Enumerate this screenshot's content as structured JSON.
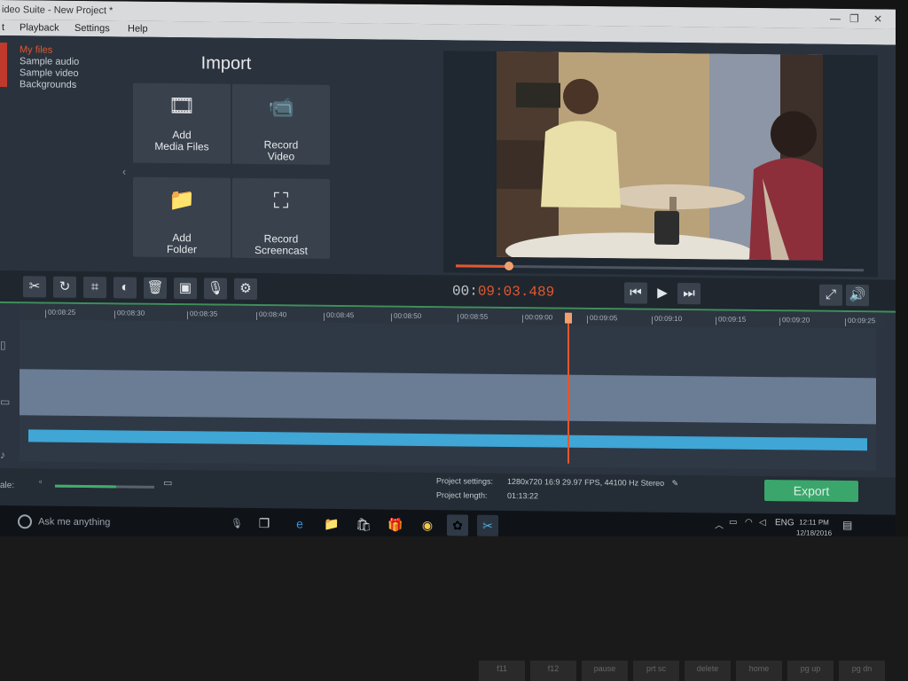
{
  "window": {
    "title": "ideo Suite - New Project *",
    "controls": [
      "—",
      "❐",
      "✕"
    ]
  },
  "menu": [
    "t",
    "Playback",
    "Settings",
    "Help"
  ],
  "sidebar": {
    "items": [
      {
        "label": "My files",
        "active": true
      },
      {
        "label": "Sample audio",
        "active": false
      },
      {
        "label": "Sample video",
        "active": false
      },
      {
        "label": "Backgrounds",
        "active": false
      }
    ]
  },
  "import": {
    "title": "Import",
    "tiles": [
      {
        "label_line1": "Add",
        "label_line2": "Media Files",
        "icon": "film-music-icon"
      },
      {
        "label_line1": "Record",
        "label_line2": "Video",
        "icon": "camera-icon"
      },
      {
        "label_line1": "Add",
        "label_line2": "Folder",
        "icon": "folder-icon"
      },
      {
        "label_line1": "Record",
        "label_line2": "Screencast",
        "icon": "screencast-icon"
      }
    ]
  },
  "toolbar": {
    "icons": [
      "scissors-icon",
      "rotate-icon",
      "crop-icon",
      "color-adjust-icon",
      "trash-icon",
      "image-icon",
      "microphone-icon",
      "gear-icon"
    ]
  },
  "player": {
    "time_prefix": "00:",
    "time_value": "09:03.489",
    "seek_progress": 0.13
  },
  "timeline": {
    "ticks": [
      "00:08:25",
      "00:08:30",
      "00:08:35",
      "00:08:40",
      "00:08:45",
      "00:08:50",
      "00:08:55",
      "00:09:00",
      "00:09:05",
      "00:09:10",
      "00:09:15",
      "00:09:20",
      "00:09:25"
    ]
  },
  "bottom": {
    "zoom_label": "ale:",
    "zoom_level": 0.62,
    "project_settings_label": "Project settings:",
    "project_settings_value": "1280x720 16:9 29.97 FPS, 44100 Hz Stereo",
    "project_length_label": "Project length:",
    "project_length_value": "01:13:22",
    "export_label": "Export"
  },
  "taskbar": {
    "search_placeholder": "Ask me anything",
    "lang": "ENG",
    "time": "12:11 PM",
    "date": "12/18/2016"
  },
  "keyboard": [
    "",
    "",
    "f11",
    "f12",
    "pause",
    "prt sc",
    "delete",
    "home",
    "pg up",
    "pg dn"
  ],
  "colors": {
    "accent": "#e4572e",
    "export": "#3aa66b",
    "track": "#3fa6d6"
  }
}
